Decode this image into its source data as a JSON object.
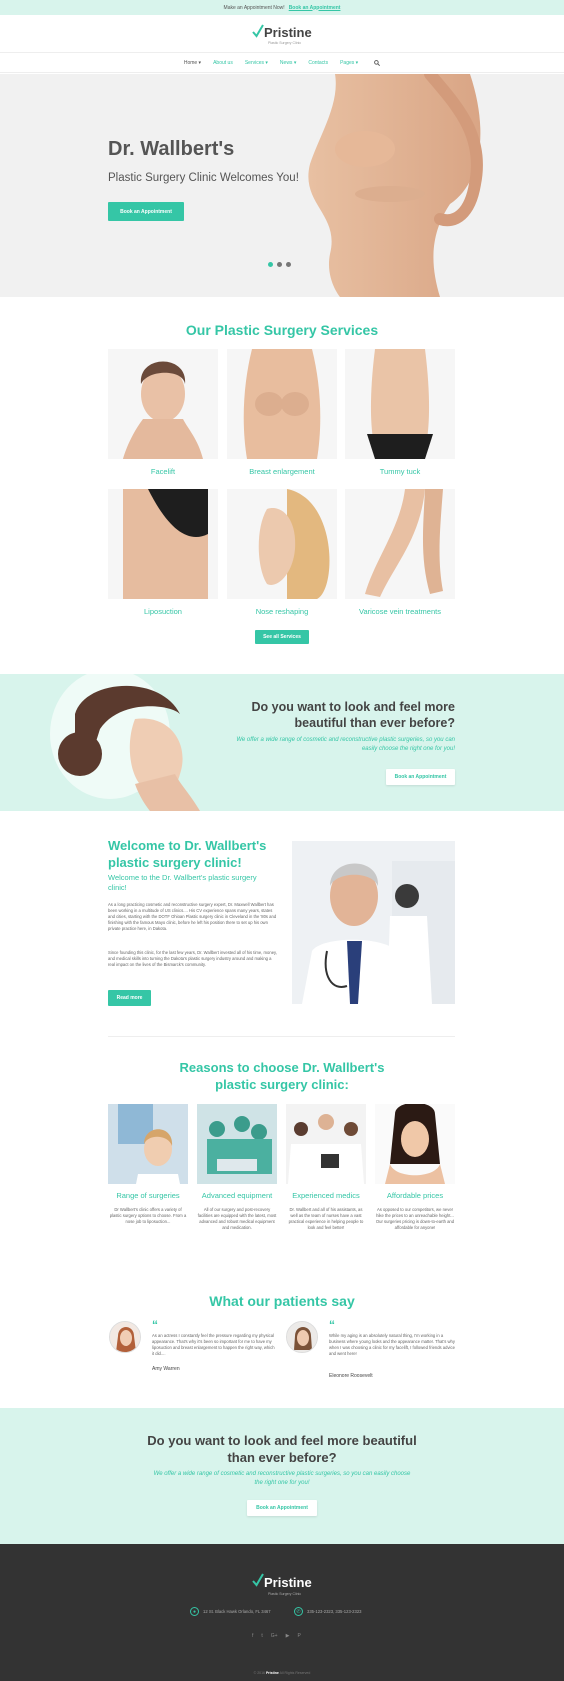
{
  "topbar": {
    "text": "Make an Appointment Now!",
    "link": "Book an Appointment"
  },
  "brand": {
    "name": "Pristine",
    "tagline": "Plastic Surgery Clinic",
    "accent": "#35c6a6"
  },
  "nav": {
    "items": [
      {
        "label": "Home"
      },
      {
        "label": "About us"
      },
      {
        "label": "Services"
      },
      {
        "label": "News"
      },
      {
        "label": "Contacts"
      },
      {
        "label": "Pages"
      }
    ],
    "search_icon": "search-icon"
  },
  "hero": {
    "title": "Dr. Wallbert's",
    "subtitle": "Plastic Surgery Clinic Welcomes You!",
    "button": "Book an Appointment",
    "slides": 3,
    "active_slide": 1
  },
  "services": {
    "title": "Our Plastic Surgery Services",
    "items": [
      {
        "label": "Facelift"
      },
      {
        "label": "Breast enlargement"
      },
      {
        "label": "Tummy tuck"
      },
      {
        "label": "Liposuction"
      },
      {
        "label": "Nose reshaping"
      },
      {
        "label": "Varicose vein treatments"
      }
    ],
    "button": "See all Services"
  },
  "promo": {
    "title": "Do you want to look and feel more beautiful than ever before?",
    "text": "We offer a wide range of cosmetic and reconstructive plastic surgeries, so you can easily choose the right one for you!",
    "button": "Book an Appointment"
  },
  "welcome": {
    "title": "Welcome to Dr. Wallbert's plastic surgery clinic!",
    "subtitle": "Welcome to the Dr. Wallbert's plastic surgery clinic!",
    "p1": "As a long practicing cosmetic and reconstructive surgery expert, Dr. Maxwell Wallbert has been working in a multitude of US clinics.... His CV experience spans many years, states and cities, starting with the DOTF Ohioan Plastic surgery clinic in Cleveland in the '80s and finishing with the famous Mayo clinic, before he left his position there to set up his own private practice here, in Dakota.",
    "p2": "Since founding this clinic, for the last few years, Dr. Wallbert invested all of his time, money, and medical skills into turning the Dakota's plastic surgery industry around and making a real impact on the lives of the Bismarck's community.",
    "button": "Read more"
  },
  "reasons": {
    "title": "Reasons to choose Dr. Wallbert's plastic surgery clinic:",
    "items": [
      {
        "label": "Range of surgeries",
        "text": "Dr Wallbert's clinic offers a variety of plastic surgery options to choose. From a nose job to liposuction..."
      },
      {
        "label": "Advanced equipment",
        "text": "All of our surgery and post-recovery facilities are equipped with the latest, most advanced and robust medical equipment and medication."
      },
      {
        "label": "Experienced medics",
        "text": "Dr. Wallbert and all of his assistants, as well as the team of nurses have a vast practical experience in helping people to look and feel better!"
      },
      {
        "label": "Affordable prices",
        "text": "As opposed to our competitors, we never hike the prices to an unreachable height... Our surgeries pricing is down-to-earth and affordable for anyone!"
      }
    ]
  },
  "testimonials": {
    "title": "What our patients say",
    "items": [
      {
        "text": "As an actress I constantly feel the pressure regarding my physical appearance. That's why it's been so important for me to have my liposuction and breast enlargement to happen the right way, which it did....",
        "name": "Amy Warren"
      },
      {
        "text": "While my aging is an absolutely natural thing, I'm working in a business where young looks and the appearance matter. That's why when I was choosing a clinic for my facelift, I followed friends advice and went here!",
        "name": "Eleonore Roosevelt"
      }
    ]
  },
  "cta": {
    "title": "Do you want to look and feel more beautiful than ever before?",
    "text": "We offer a wide range of cosmetic and reconstructive plastic surgeries, so you can easily choose the right one for you!",
    "button": "Book an Appointment"
  },
  "footer": {
    "name": "Pristine",
    "tagline": "Plastic Surgery Clinic",
    "address": "12 St. Black Hawk Orlando, FL 3467",
    "phone": "335-123-2323, 335-123-2323",
    "social_icons": [
      "facebook-icon",
      "twitter-icon",
      "google-plus-icon",
      "youtube-icon",
      "pinterest-icon"
    ],
    "copyright_brand": "Pristine",
    "copyright_rest": "All Rights Reserved"
  }
}
